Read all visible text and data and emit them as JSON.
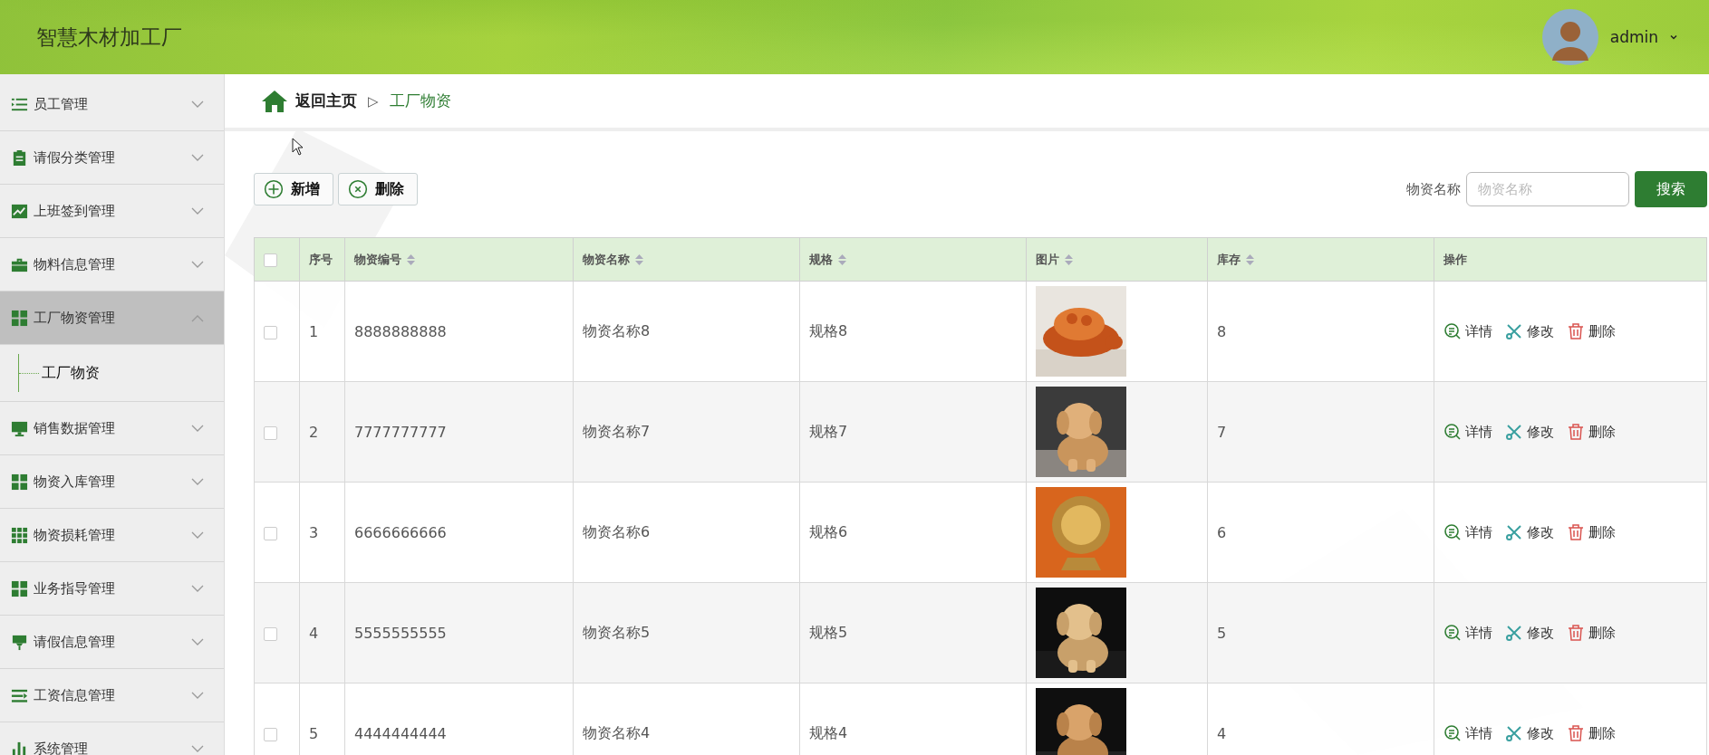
{
  "header": {
    "title": "智慧木材加工厂",
    "user": "admin"
  },
  "menu": [
    {
      "label": "员工管理",
      "kind": "list",
      "expanded": false,
      "selected": false
    },
    {
      "label": "请假分类管理",
      "kind": "clipboard",
      "expanded": false,
      "selected": false
    },
    {
      "label": "上班签到管理",
      "kind": "chart",
      "expanded": false,
      "selected": false
    },
    {
      "label": "物料信息管理",
      "kind": "briefcase",
      "expanded": false,
      "selected": false
    },
    {
      "label": "工厂物资管理",
      "kind": "grid",
      "expanded": true,
      "selected": true,
      "children": [
        {
          "label": "工厂物资"
        }
      ]
    },
    {
      "label": "销售数据管理",
      "kind": "monitor",
      "expanded": false,
      "selected": false
    },
    {
      "label": "物资入库管理",
      "kind": "grid",
      "expanded": false,
      "selected": false
    },
    {
      "label": "物资损耗管理",
      "kind": "grid9",
      "expanded": false,
      "selected": false
    },
    {
      "label": "业务指导管理",
      "kind": "grid",
      "expanded": false,
      "selected": false
    },
    {
      "label": "请假信息管理",
      "kind": "brush",
      "expanded": false,
      "selected": false
    },
    {
      "label": "工资信息管理",
      "kind": "list2",
      "expanded": false,
      "selected": false
    },
    {
      "label": "系统管理",
      "kind": "bars",
      "expanded": false,
      "selected": false
    }
  ],
  "breadcrumb": {
    "home": "返回主页",
    "separator": "▷",
    "current": "工厂物资"
  },
  "toolbar": [
    {
      "label": "新增",
      "kind": "add"
    },
    {
      "label": "删除",
      "kind": "delete"
    }
  ],
  "search": {
    "label": "物资名称",
    "placeholder": "物资名称",
    "button": "搜索"
  },
  "table": {
    "select_all": {
      "checked": false
    },
    "columns": [
      {
        "label": "序号",
        "sortable": false
      },
      {
        "label": "物资编号",
        "sortable": true
      },
      {
        "label": "物资名称",
        "sortable": true
      },
      {
        "label": "规格",
        "sortable": true
      },
      {
        "label": "图片",
        "sortable": true
      },
      {
        "label": "库存",
        "sortable": true
      },
      {
        "label": "操作",
        "sortable": false
      }
    ],
    "rows": [
      {
        "checked": false,
        "index": "1",
        "code": "8888888888",
        "name": "物资名称8",
        "spec": "规格8",
        "stock": "8",
        "actions": [
          {
            "label": "详情",
            "kind": "detail"
          },
          {
            "label": "修改",
            "kind": "edit"
          },
          {
            "label": "删除",
            "kind": "delete"
          }
        ]
      },
      {
        "checked": false,
        "index": "2",
        "code": "7777777777",
        "name": "物资名称7",
        "spec": "规格7",
        "stock": "7",
        "actions": [
          {
            "label": "详情",
            "kind": "detail"
          },
          {
            "label": "修改",
            "kind": "edit"
          },
          {
            "label": "删除",
            "kind": "delete"
          }
        ]
      },
      {
        "checked": false,
        "index": "3",
        "code": "6666666666",
        "name": "物资名称6",
        "spec": "规格6",
        "stock": "6",
        "actions": [
          {
            "label": "详情",
            "kind": "detail"
          },
          {
            "label": "修改",
            "kind": "edit"
          },
          {
            "label": "删除",
            "kind": "delete"
          }
        ]
      },
      {
        "checked": false,
        "index": "4",
        "code": "5555555555",
        "name": "物资名称5",
        "spec": "规格5",
        "stock": "5",
        "actions": [
          {
            "label": "详情",
            "kind": "detail"
          },
          {
            "label": "修改",
            "kind": "edit"
          },
          {
            "label": "删除",
            "kind": "delete"
          }
        ]
      },
      {
        "checked": false,
        "index": "5",
        "code": "4444444444",
        "name": "物资名称4",
        "spec": "规格4",
        "stock": "4",
        "actions": [
          {
            "label": "详情",
            "kind": "detail"
          },
          {
            "label": "修改",
            "kind": "edit"
          },
          {
            "label": "删除",
            "kind": "delete"
          }
        ]
      }
    ]
  }
}
